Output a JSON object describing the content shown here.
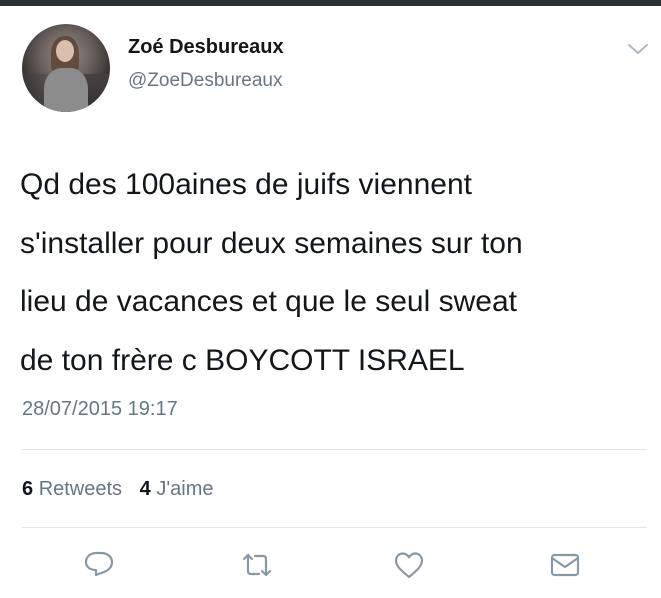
{
  "author": {
    "name": "Zoé Desbureaux",
    "handle": "@ZoeDesbureaux"
  },
  "tweet": {
    "lines": [
      "Qd des 100aines de juifs viennent",
      "s'installer pour deux semaines sur ton",
      "lieu de vacances et que le seul sweat",
      "de ton frère c BOYCOTT ISRAEL"
    ],
    "timestamp": "28/07/2015 19:17"
  },
  "stats": {
    "retweets_count": "6",
    "retweets_label": "Retweets",
    "likes_count": "4",
    "likes_label": "J'aime"
  },
  "colors": {
    "text": "#14171a",
    "secondary": "#657786",
    "divider": "#e1e8ed",
    "icon": "#8899a6"
  },
  "icons": {
    "menu": "chevron-down-icon",
    "reply": "reply-icon",
    "retweet": "retweet-icon",
    "like": "heart-icon",
    "dm": "envelope-icon"
  }
}
